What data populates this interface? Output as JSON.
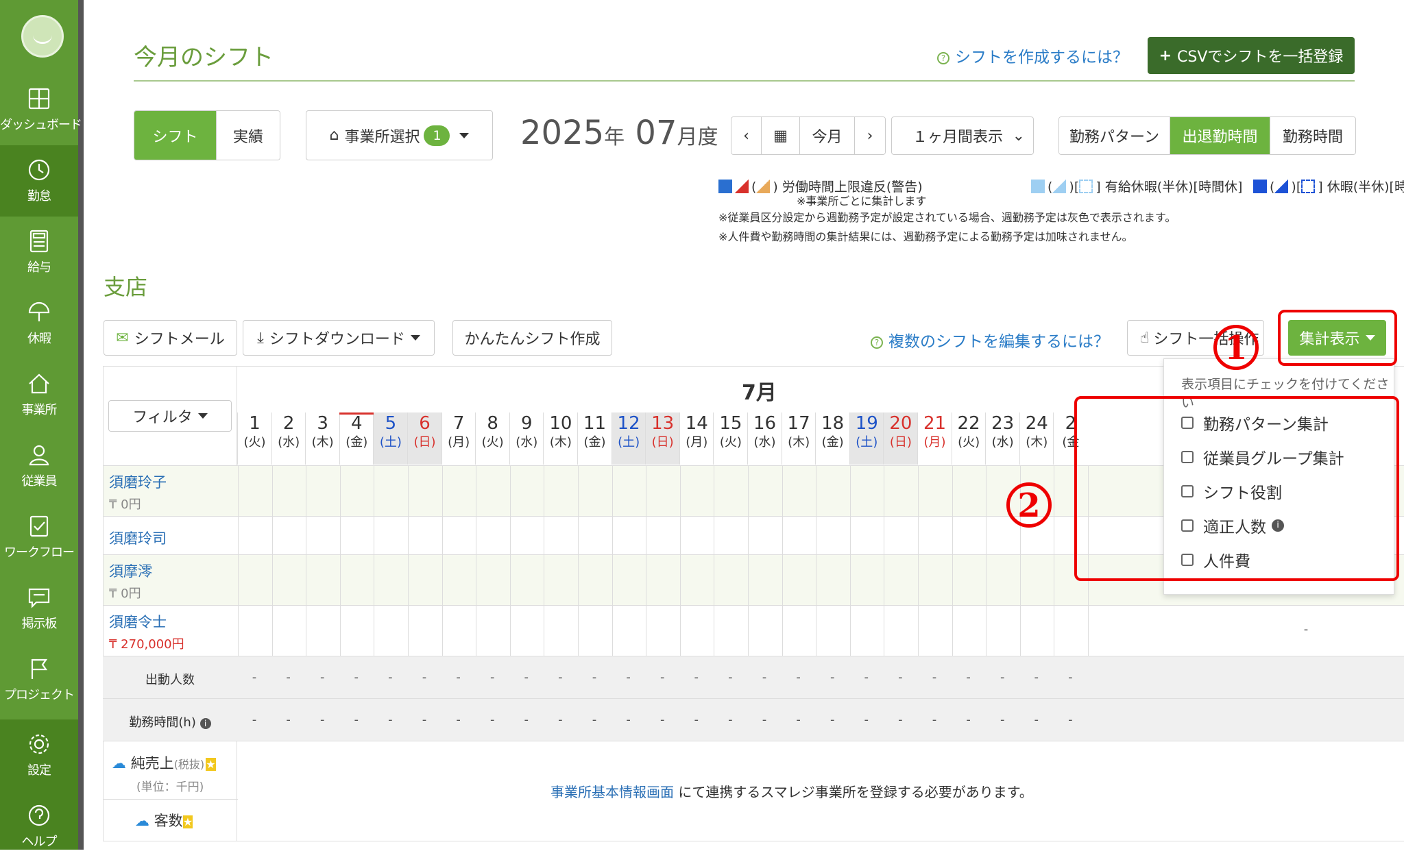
{
  "sidebar": {
    "items": [
      {
        "label": "ダッシュボード",
        "icon": "dashboard-icon"
      },
      {
        "label": "勤怠",
        "icon": "clock-icon"
      },
      {
        "label": "給与",
        "icon": "calculator-icon"
      },
      {
        "label": "休暇",
        "icon": "umbrella-icon"
      },
      {
        "label": "事業所",
        "icon": "home-icon"
      },
      {
        "label": "従業員",
        "icon": "person-icon"
      },
      {
        "label": "ワークフロー",
        "icon": "checklist-icon"
      },
      {
        "label": "掲示板",
        "icon": "chat-icon"
      },
      {
        "label": "プロジェクト",
        "icon": "flag-icon"
      },
      {
        "label": "設定",
        "icon": "gear-icon"
      },
      {
        "label": "ヘルプ",
        "icon": "help-icon"
      }
    ]
  },
  "header": {
    "title": "今月のシフト",
    "help_link": "シフトを作成するには？",
    "csv_button": "CSVでシフトを一括登録"
  },
  "toolbar": {
    "tab_shift": "シフト",
    "tab_actual": "実績",
    "office_select": "事業所選択",
    "office_count": "1",
    "year": "2025",
    "year_unit": "年",
    "month": "07",
    "month_unit": "月度",
    "today": "今月",
    "period": "１ヶ月間表示",
    "view_pattern": "勤務パターン",
    "view_inout": "出退勤時間",
    "view_hours": "勤務時間"
  },
  "legend": {
    "item1": "労働時間上限違反(警告)",
    "item1_note": "※事業所ごとに集計します",
    "item2": "有給休暇(半休)[時間休]",
    "item3": "休暇(半休)[時間休]",
    "note1": "※従業員区分設定から週勤務予定が設定されている場合、週勤務予定は灰色で表示されます。",
    "note2": "※人件費や勤務時間の集計結果には、週勤務予定による勤務予定は加味されません。"
  },
  "branch": {
    "name": "支店",
    "shift_mail": "シフトメール",
    "shift_download": "シフトダウンロード",
    "easy_shift": "かんたんシフト作成",
    "multi_help": "複数のシフトを編集するには？",
    "bulk_op": "シフト一括操作",
    "summary_button": "集計表示"
  },
  "grid": {
    "filter": "フィルタ",
    "month_label": "7月",
    "days": [
      {
        "d": "1",
        "w": "(火)",
        "t": ""
      },
      {
        "d": "2",
        "w": "(水)",
        "t": ""
      },
      {
        "d": "3",
        "w": "(木)",
        "t": ""
      },
      {
        "d": "4",
        "w": "(金)",
        "t": ""
      },
      {
        "d": "5",
        "w": "(土)",
        "t": "sat"
      },
      {
        "d": "6",
        "w": "(日)",
        "t": "sun"
      },
      {
        "d": "7",
        "w": "(月)",
        "t": ""
      },
      {
        "d": "8",
        "w": "(火)",
        "t": ""
      },
      {
        "d": "9",
        "w": "(水)",
        "t": ""
      },
      {
        "d": "10",
        "w": "(木)",
        "t": ""
      },
      {
        "d": "11",
        "w": "(金)",
        "t": ""
      },
      {
        "d": "12",
        "w": "(土)",
        "t": "sat"
      },
      {
        "d": "13",
        "w": "(日)",
        "t": "sun"
      },
      {
        "d": "14",
        "w": "(月)",
        "t": ""
      },
      {
        "d": "15",
        "w": "(火)",
        "t": ""
      },
      {
        "d": "16",
        "w": "(水)",
        "t": ""
      },
      {
        "d": "17",
        "w": "(木)",
        "t": ""
      },
      {
        "d": "18",
        "w": "(金)",
        "t": ""
      },
      {
        "d": "19",
        "w": "(土)",
        "t": "sat"
      },
      {
        "d": "20",
        "w": "(日)",
        "t": "sun"
      },
      {
        "d": "21",
        "w": "(月)",
        "t": "hol"
      },
      {
        "d": "22",
        "w": "(火)",
        "t": ""
      },
      {
        "d": "23",
        "w": "(水)",
        "t": ""
      },
      {
        "d": "24",
        "w": "(木)",
        "t": ""
      },
      {
        "d": "2",
        "w": "(金",
        "t": ""
      }
    ],
    "employees": [
      {
        "name": "須磨玲子",
        "wage": "₸ 0円",
        "wage_red": false
      },
      {
        "name": "須磨玲司",
        "wage": "",
        "wage_red": false
      },
      {
        "name": "須摩澪",
        "wage": "₸ 0円",
        "wage_red": false
      },
      {
        "name": "須磨令士",
        "wage": "₸ 270,000円",
        "wage_red": true
      }
    ],
    "row_attendance": "出動人数",
    "row_hours": "勤務時間(h)",
    "dash": "-",
    "sales": "純売上",
    "sales_tax": "(税抜)",
    "sales_unit": "(単位：千円)",
    "customers": "客数",
    "link_text": "事業所基本情報画面",
    "link_suffix": "にて連携するスマレジ事業所を登録する必要があります。"
  },
  "dropdown": {
    "head": "表示項目にチェックを付けてください",
    "options": [
      "勤務パターン集計",
      "従業員グループ集計",
      "シフト役割",
      "適正人数",
      "人件費"
    ]
  },
  "annotations": {
    "n1": "1",
    "n2": "2"
  },
  "colors": {
    "brand_green": "#6db33f",
    "dark_green": "#3a6b2a",
    "sidebar": "#5f9a34",
    "highlight_red": "#e00000"
  }
}
